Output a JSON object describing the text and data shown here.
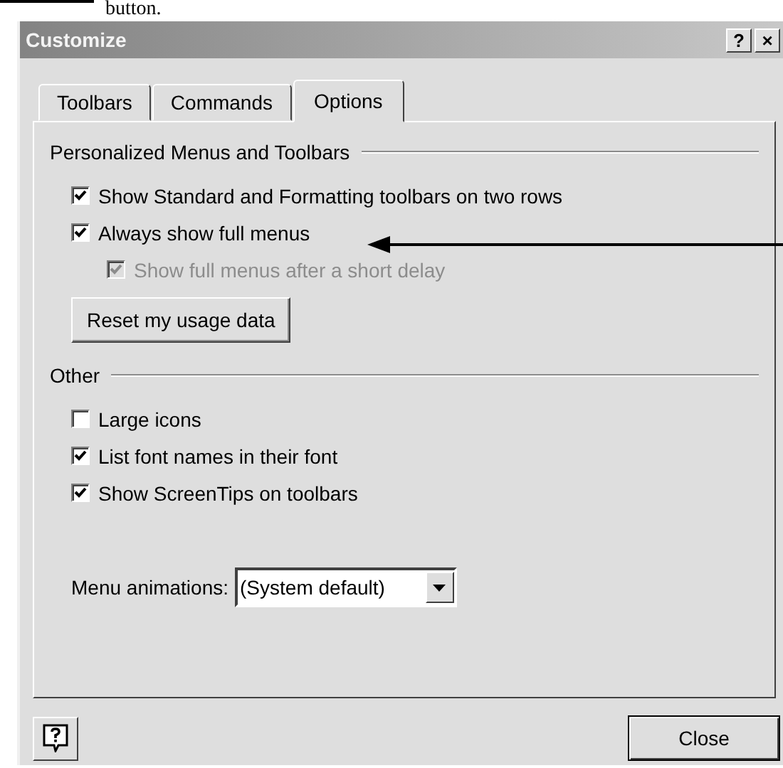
{
  "caption": "button.",
  "window": {
    "title": "Customize",
    "title_buttons": [
      "?",
      "×"
    ]
  },
  "tabs": [
    {
      "label": "Toolbars",
      "selected": false
    },
    {
      "label": "Commands",
      "selected": false
    },
    {
      "label": "Options",
      "selected": true
    }
  ],
  "groups": [
    {
      "title": "Personalized Menus and Toolbars",
      "items": [
        {
          "kind": "checkbox",
          "label": "Show Standard and Formatting toolbars on two rows",
          "checked": true,
          "disabled": false
        },
        {
          "kind": "checkbox",
          "label": "Always show full menus",
          "checked": true,
          "disabled": false,
          "children": [
            {
              "kind": "checkbox",
              "label": "Show full menus after a short delay",
              "checked": true,
              "disabled": true
            }
          ]
        },
        {
          "kind": "button",
          "label": "Reset my usage data"
        }
      ]
    },
    {
      "title": "Other",
      "items": [
        {
          "kind": "checkbox",
          "label": "Large icons",
          "checked": false,
          "disabled": false
        },
        {
          "kind": "checkbox",
          "label": "List font names in their font",
          "checked": true,
          "disabled": false
        },
        {
          "kind": "checkbox",
          "label": "Show ScreenTips on toolbars",
          "checked": true,
          "disabled": false
        },
        {
          "kind": "dropdown",
          "label": "Menu animations:",
          "value": "(System default)"
        }
      ]
    }
  ],
  "footer": {
    "close": "Close"
  }
}
